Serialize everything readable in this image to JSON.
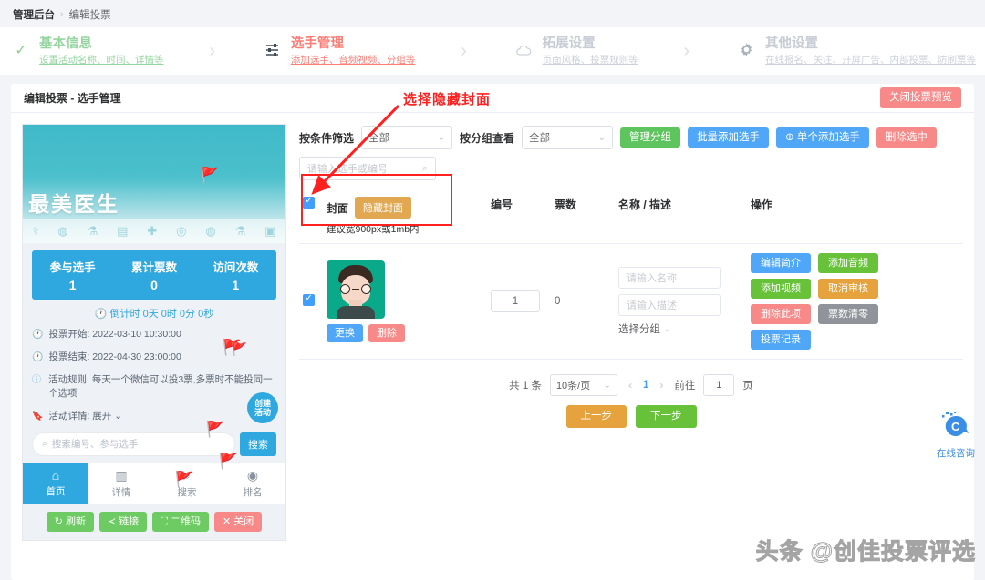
{
  "breadcrumb": {
    "root": "管理后台",
    "separator": "›",
    "current": "编辑投票"
  },
  "steps": [
    {
      "icon": "check-icon",
      "glyph": "✓",
      "title": "基本信息",
      "sub": "设置活动名称、时间、详情等",
      "state": "done"
    },
    {
      "icon": "sliders-icon",
      "glyph": "⚊",
      "title": "选手管理",
      "sub": "添加选手、音频视频、分组等",
      "state": "active"
    },
    {
      "icon": "cloud-icon",
      "glyph": "☁",
      "title": "拓展设置",
      "sub": "页面风格、投票规则等",
      "state": "todo"
    },
    {
      "icon": "gear-icon",
      "glyph": "✿",
      "title": "其他设置",
      "sub": "在线报名、关注、开屏广告、内部投票、防刷票等",
      "state": "todo"
    }
  ],
  "step_arrow": "›",
  "card": {
    "title": "编辑投票 - 选手管理",
    "close_preview_label": "关闭投票预览"
  },
  "annotation": {
    "text": "选择隐藏封面",
    "color": "#ff2020"
  },
  "preview": {
    "banner_title": "最美医生",
    "stats": [
      {
        "label": "参与选手",
        "value": "1"
      },
      {
        "label": "累计票数",
        "value": "0"
      },
      {
        "label": "访问次数",
        "value": "1"
      }
    ],
    "countdown": "🕐 倒计时 0天 0时 0分 0秒",
    "info": [
      {
        "icon": "clock-icon",
        "glyph": "🕐",
        "text": "投票开始: 2022-03-10 10:30:00"
      },
      {
        "icon": "clock-end-icon",
        "glyph": "🕐",
        "text": "投票结束: 2022-04-30 23:00:00"
      },
      {
        "icon": "info-icon",
        "glyph": "ⓘ",
        "text": "活动规则: 每天一个微信可以投3票,多票时不能投同一个选项"
      },
      {
        "icon": "bookmark-icon",
        "glyph": "🔖",
        "text": "活动详情: 展开 ⌄"
      }
    ],
    "search_placeholder": "搜索编号、参与选手",
    "search_button": "搜索",
    "create_badge": {
      "line1": "创建",
      "line2": "活动"
    },
    "tabs": [
      {
        "icon": "home-icon",
        "glyph": "⌂",
        "label": "首页",
        "active": true
      },
      {
        "icon": "chart-icon",
        "glyph": "▥",
        "label": "详情",
        "active": false
      },
      {
        "icon": "search-icon",
        "glyph": "⌕",
        "label": "搜索",
        "active": false
      },
      {
        "icon": "medal-icon",
        "glyph": "◉",
        "label": "排名",
        "active": false
      }
    ],
    "foot_buttons": [
      {
        "icon": "refresh-icon",
        "glyph": "↻",
        "label": "刷新",
        "color": "green"
      },
      {
        "icon": "share-icon",
        "glyph": "≺",
        "label": "链接",
        "color": "green"
      },
      {
        "icon": "qrcode-icon",
        "glyph": "⛶",
        "label": "二维码",
        "color": "green"
      },
      {
        "icon": "close-icon",
        "glyph": "✕",
        "label": "关闭",
        "color": "red"
      }
    ]
  },
  "toolbar": {
    "filter_label": "按条件筛选",
    "filter_value": "全部",
    "group_label": "按分组查看",
    "group_value": "全部",
    "manage_group": "管理分组",
    "batch_add": "批量添加选手",
    "single_add": "⊕ 单个添加选手",
    "delete_selected": "删除选中",
    "search_placeholder": "请输入选手或编号",
    "search_icon": "⌕"
  },
  "table": {
    "headers": {
      "cover": "封面",
      "hide_cover_button": "隐藏封面",
      "cover_hint": "建议宽900px或1mb内",
      "number": "编号",
      "votes": "票数",
      "name_desc": "名称 / 描述",
      "actions": "操作"
    },
    "rows": [
      {
        "checked": true,
        "cover_replace": "更换",
        "cover_delete": "删除",
        "number": "1",
        "votes": "0",
        "name_placeholder": "请输入名称",
        "desc_placeholder": "请输入描述",
        "group_label": "选择分组",
        "actions": [
          {
            "label": "编辑简介",
            "color": "blue"
          },
          {
            "label": "添加音频",
            "color": "green"
          },
          {
            "label": "添加视频",
            "color": "green"
          },
          {
            "label": "取消审核",
            "color": "orange"
          },
          {
            "label": "删除此项",
            "color": "red"
          },
          {
            "label": "票数清零",
            "color": "gray"
          },
          {
            "label": "投票记录",
            "color": "blue"
          }
        ]
      }
    ]
  },
  "pagination": {
    "total": "共 1 条",
    "page_size": "10条/页",
    "prev_arrow": "‹",
    "next_arrow": "›",
    "current_page": "1",
    "goto_label": "前往",
    "goto_value": "1",
    "page_unit": "页",
    "prev_step": "上一步",
    "next_step": "下一步"
  },
  "consult": {
    "icon": "chat-icon",
    "label": "在线咨询"
  },
  "watermark": "头条 @创佳投票评选"
}
